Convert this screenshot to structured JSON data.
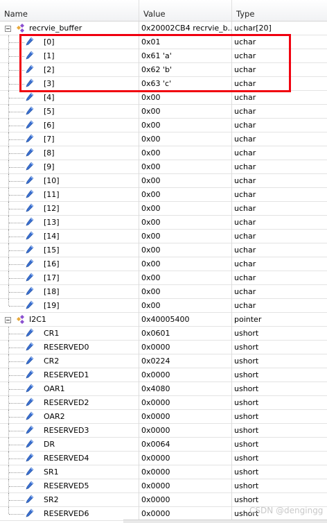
{
  "header": {
    "name": "Name",
    "value": "Value",
    "type": "Type"
  },
  "groups": [
    {
      "name": "recrvie_buffer",
      "value": "0x20002CB4 recrvie_b...",
      "type": "uchar[20]",
      "children": [
        {
          "name": "[0]",
          "value": "0x01",
          "type": "uchar"
        },
        {
          "name": "[1]",
          "value": "0x61 'a'",
          "type": "uchar"
        },
        {
          "name": "[2]",
          "value": "0x62 'b'",
          "type": "uchar"
        },
        {
          "name": "[3]",
          "value": "0x63 'c'",
          "type": "uchar"
        },
        {
          "name": "[4]",
          "value": "0x00",
          "type": "uchar"
        },
        {
          "name": "[5]",
          "value": "0x00",
          "type": "uchar"
        },
        {
          "name": "[6]",
          "value": "0x00",
          "type": "uchar"
        },
        {
          "name": "[7]",
          "value": "0x00",
          "type": "uchar"
        },
        {
          "name": "[8]",
          "value": "0x00",
          "type": "uchar"
        },
        {
          "name": "[9]",
          "value": "0x00",
          "type": "uchar"
        },
        {
          "name": "[10]",
          "value": "0x00",
          "type": "uchar"
        },
        {
          "name": "[11]",
          "value": "0x00",
          "type": "uchar"
        },
        {
          "name": "[12]",
          "value": "0x00",
          "type": "uchar"
        },
        {
          "name": "[13]",
          "value": "0x00",
          "type": "uchar"
        },
        {
          "name": "[14]",
          "value": "0x00",
          "type": "uchar"
        },
        {
          "name": "[15]",
          "value": "0x00",
          "type": "uchar"
        },
        {
          "name": "[16]",
          "value": "0x00",
          "type": "uchar"
        },
        {
          "name": "[17]",
          "value": "0x00",
          "type": "uchar"
        },
        {
          "name": "[18]",
          "value": "0x00",
          "type": "uchar"
        },
        {
          "name": "[19]",
          "value": "0x00",
          "type": "uchar"
        }
      ]
    },
    {
      "name": "I2C1",
      "value": "0x40005400",
      "type": "pointer",
      "children": [
        {
          "name": "CR1",
          "value": "0x0601",
          "type": "ushort"
        },
        {
          "name": "RESERVED0",
          "value": "0x0000",
          "type": "ushort"
        },
        {
          "name": "CR2",
          "value": "0x0224",
          "type": "ushort"
        },
        {
          "name": "RESERVED1",
          "value": "0x0000",
          "type": "ushort"
        },
        {
          "name": "OAR1",
          "value": "0x4080",
          "type": "ushort"
        },
        {
          "name": "RESERVED2",
          "value": "0x0000",
          "type": "ushort"
        },
        {
          "name": "OAR2",
          "value": "0x0000",
          "type": "ushort"
        },
        {
          "name": "RESERVED3",
          "value": "0x0000",
          "type": "ushort"
        },
        {
          "name": "DR",
          "value": "0x0064",
          "type": "ushort"
        },
        {
          "name": "RESERVED4",
          "value": "0x0000",
          "type": "ushort"
        },
        {
          "name": "SR1",
          "value": "0x0000",
          "type": "ushort"
        },
        {
          "name": "RESERVED5",
          "value": "0x0000",
          "type": "ushort"
        },
        {
          "name": "SR2",
          "value": "0x0000",
          "type": "ushort"
        },
        {
          "name": "RESERVED6",
          "value": "0x0000",
          "type": "ushort"
        }
      ]
    }
  ],
  "watermark": "CSDN @dengingg",
  "colors": {
    "highlight": "#f0000f",
    "child_icon": "#3a6fd0",
    "struct_icon_a": "#e8a93c",
    "struct_icon_b": "#8a4fcf"
  }
}
